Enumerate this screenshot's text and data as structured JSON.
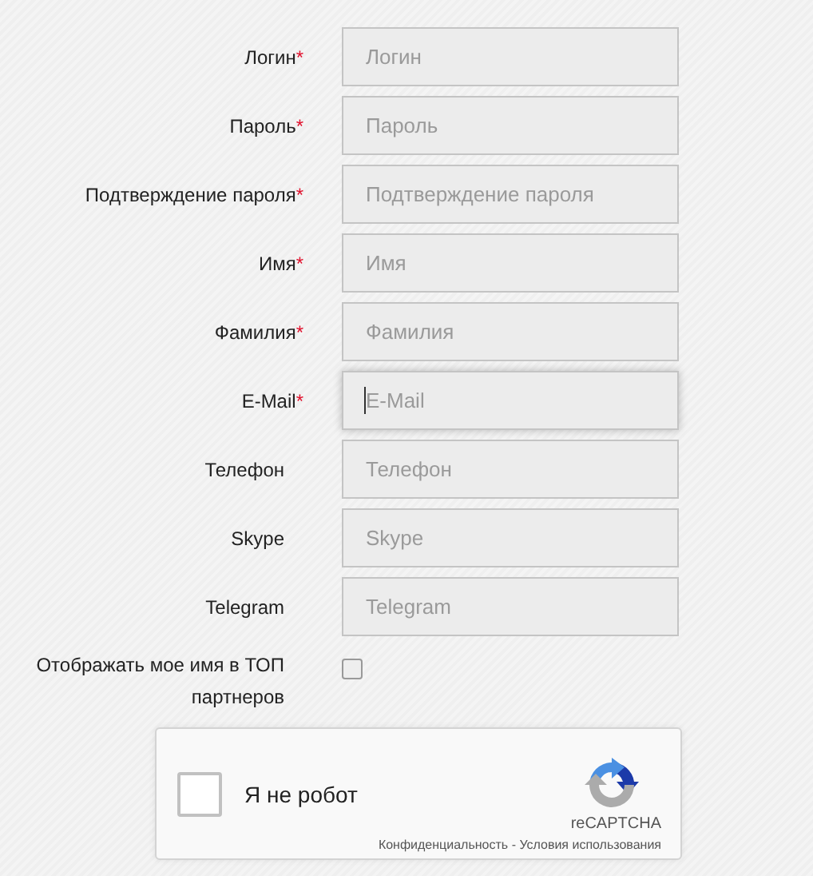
{
  "fields": [
    {
      "label": "Логин",
      "required_mark": "*",
      "placeholder": "Логин",
      "focused": false
    },
    {
      "label": "Пароль",
      "required_mark": "*",
      "placeholder": "Пароль",
      "focused": false
    },
    {
      "label": "Подтверждение пароля",
      "required_mark": "*",
      "placeholder": "Подтверждение пароля",
      "focused": false
    },
    {
      "label": "Имя",
      "required_mark": "*",
      "placeholder": "Имя",
      "focused": false
    },
    {
      "label": "Фамилия",
      "required_mark": "*",
      "placeholder": "Фамилия",
      "focused": false
    },
    {
      "label": "E-Mail",
      "required_mark": "*",
      "placeholder": "E-Mail",
      "focused": true
    },
    {
      "label": "Телефон",
      "placeholder": "Телефон",
      "focused": false
    },
    {
      "label": "Skype",
      "placeholder": "Skype",
      "focused": false
    },
    {
      "label": "Telegram",
      "placeholder": "Telegram",
      "focused": false
    }
  ],
  "top_option": {
    "label": "Отображать мое имя в ТОП партнеров",
    "checked": false
  },
  "captcha": {
    "label": "Я не робот",
    "checked": false,
    "brand": "reCAPTCHA",
    "privacy_link": "Конфиденциальность",
    "separator": " - ",
    "terms_link": "Условия использования"
  }
}
